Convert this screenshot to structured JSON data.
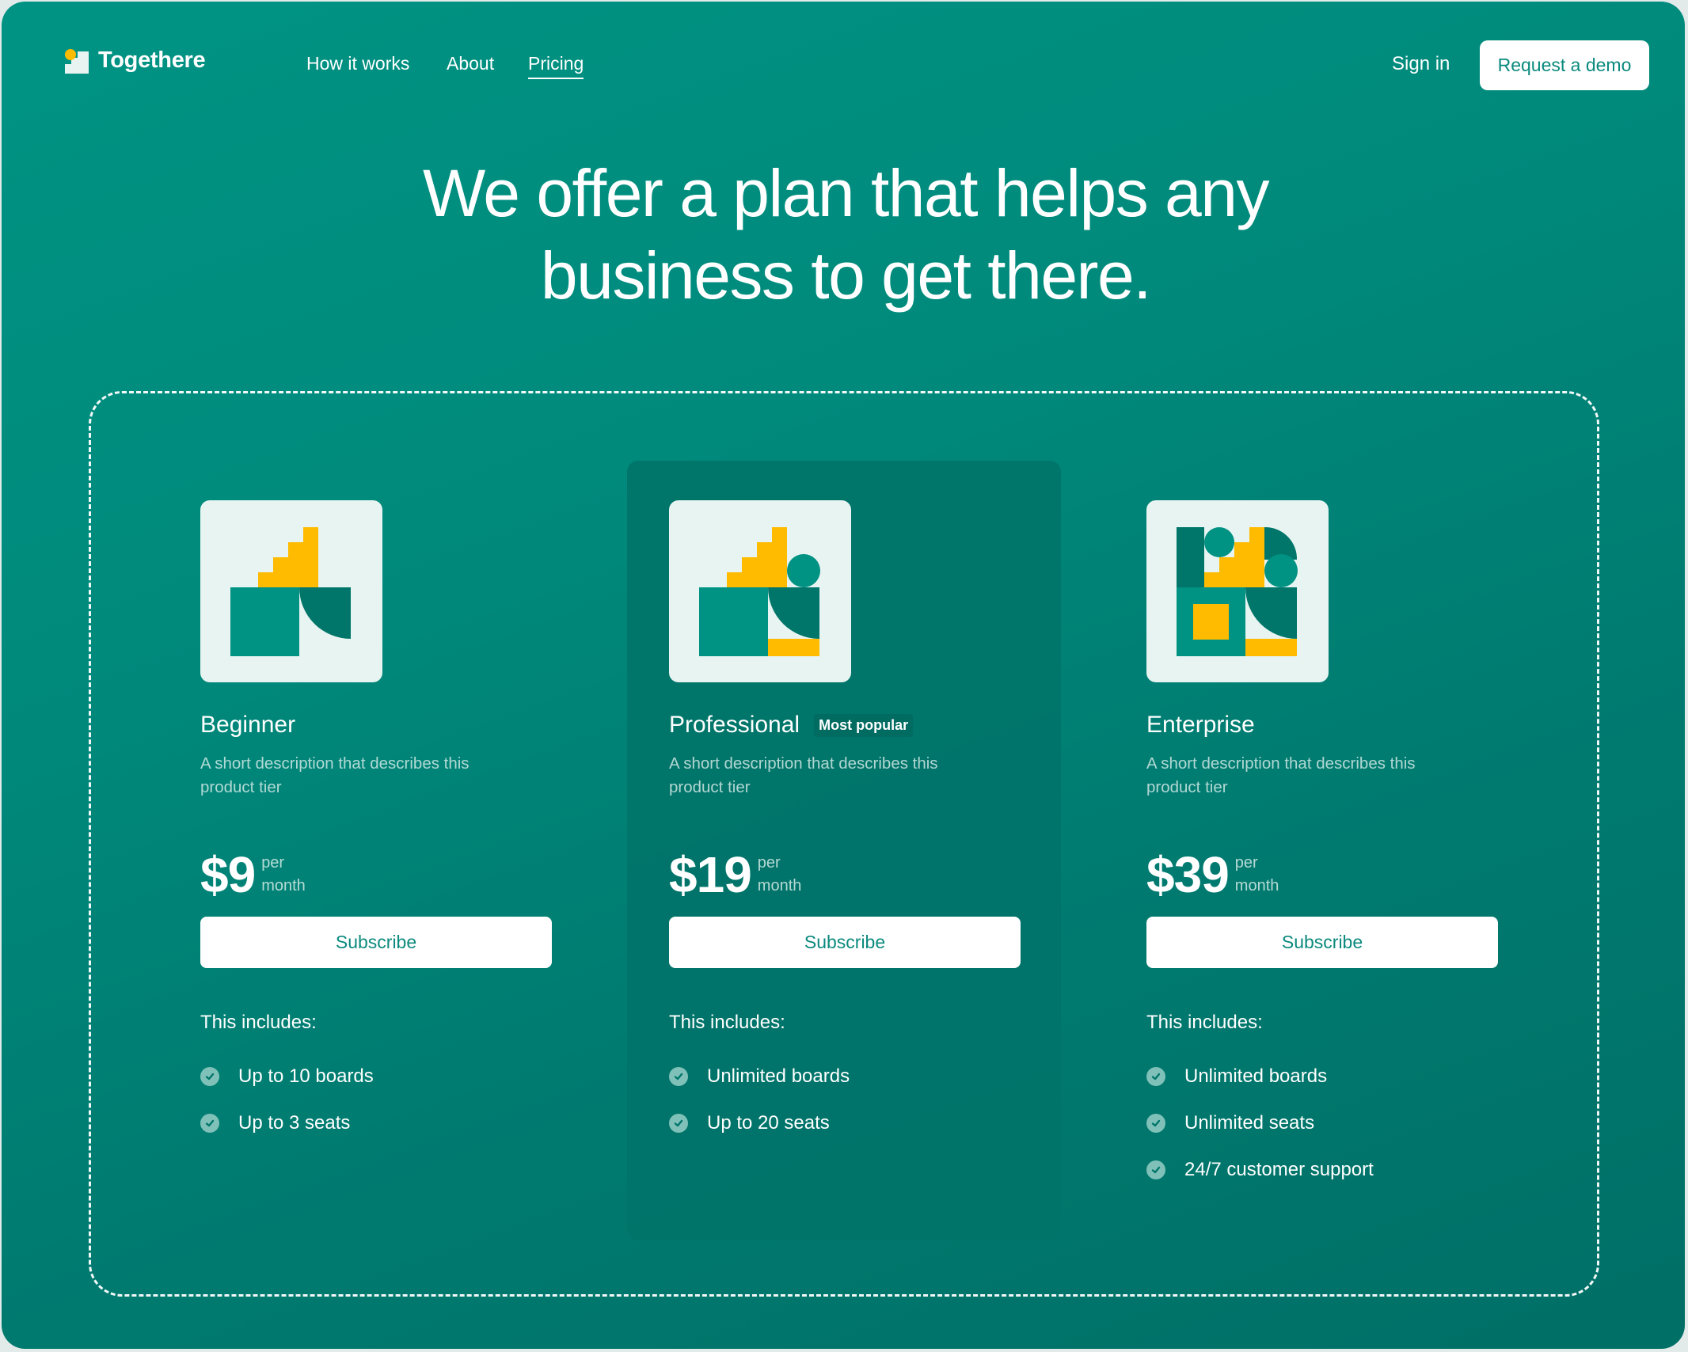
{
  "nav": {
    "brand": "Togethere",
    "links": [
      {
        "label": "How it works",
        "active": false
      },
      {
        "label": "About",
        "active": false
      },
      {
        "label": "Pricing",
        "active": true
      }
    ],
    "sign_in": "Sign in",
    "request_demo": "Request a demo"
  },
  "hero": {
    "line1": "We offer a plan that helps any",
    "line2": "business to get there."
  },
  "colors": {
    "brand_teal": "#00897b",
    "card_teal": "#007469",
    "accent_yellow": "#ffbb00",
    "button_text": "#0b8a7d"
  },
  "tiers": [
    {
      "name": "Beginner",
      "badge": "",
      "description": "A short description that describes this product tier",
      "price": "$9",
      "per_line1": "per",
      "per_line2": "month",
      "cta": "Subscribe",
      "includes_label": "This includes:",
      "features": [
        "Up to 10 boards",
        "Up to 3 seats"
      ],
      "icon": "beginner-illustration-icon"
    },
    {
      "name": "Professional",
      "badge": "Most popular",
      "description": "A short description that describes this product tier",
      "price": "$19",
      "per_line1": "per",
      "per_line2": "month",
      "cta": "Subscribe",
      "includes_label": "This includes:",
      "features": [
        "Unlimited boards",
        "Up to 20 seats"
      ],
      "icon": "professional-illustration-icon"
    },
    {
      "name": "Enterprise",
      "badge": "",
      "description": "A short description that describes this product tier",
      "price": "$39",
      "per_line1": "per",
      "per_line2": "month",
      "cta": "Subscribe",
      "includes_label": "This includes:",
      "features": [
        "Unlimited boards",
        "Unlimited seats",
        "24/7 customer support"
      ],
      "icon": "enterprise-illustration-icon"
    }
  ]
}
